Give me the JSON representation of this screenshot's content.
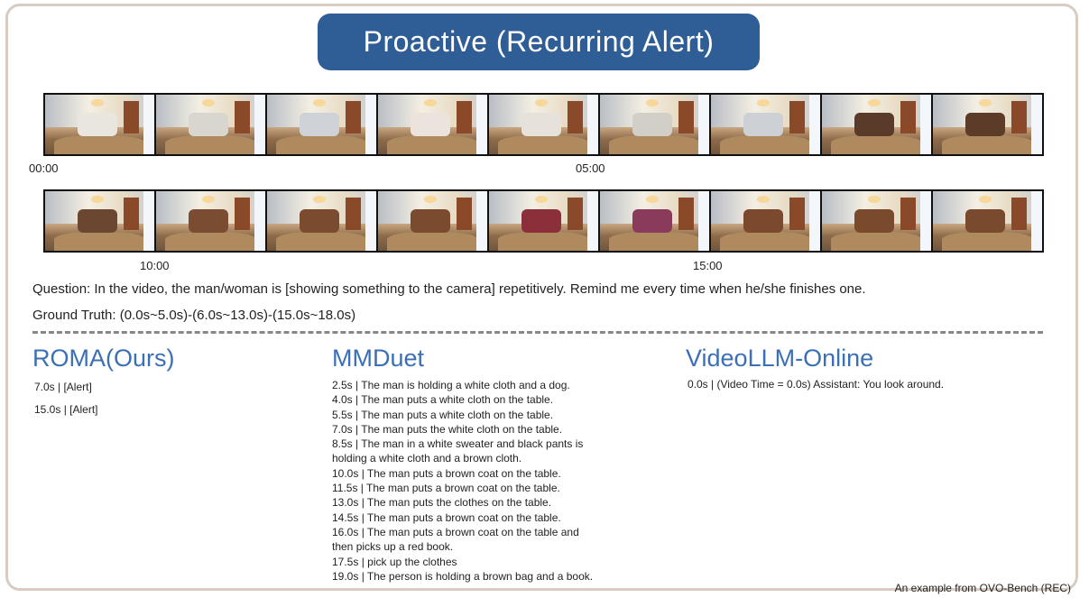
{
  "title": "Proactive (Recurring Alert)",
  "timeline": {
    "labels": [
      "00:00",
      "05:00",
      "10:00",
      "15:00"
    ]
  },
  "strips": {
    "row1": [
      {
        "obj": "#e9e6e0"
      },
      {
        "obj": "#d9d6cf"
      },
      {
        "obj": "#cfd2d6"
      },
      {
        "obj": "#ece4dc"
      },
      {
        "obj": "#e6e1da"
      },
      {
        "obj": "#d2cfc8"
      },
      {
        "obj": "#cdd0d4"
      },
      {
        "obj": "#5a3a28"
      },
      {
        "obj": "#5c3b29"
      }
    ],
    "row2": [
      {
        "obj": "#6b4630"
      },
      {
        "obj": "#7a4d33"
      },
      {
        "obj": "#7a4b2e"
      },
      {
        "obj": "#7b4b2f"
      },
      {
        "obj": "#8b2f3a"
      },
      {
        "obj": "#8a3a5a"
      },
      {
        "obj": "#7b4a2e"
      },
      {
        "obj": "#7a4a2d"
      },
      {
        "obj": "#7a4a2e"
      }
    ]
  },
  "question": "Question: In the video, the man/woman is [showing something to the camera] repetitively. Remind me every time when he/she finishes one.",
  "ground_truth": "Ground Truth: (0.0s~5.0s)-(6.0s~13.0s)-(15.0s~18.0s)",
  "columns": {
    "roma": {
      "title": "ROMA(Ours)",
      "lines": [
        "7.0s  | [Alert]",
        "15.0s | [Alert]"
      ]
    },
    "mmduet": {
      "title": "MMDuet",
      "lines": [
        "2.5s | The man is holding a white cloth and a dog.",
        "4.0s | The man puts a white cloth on the table.",
        "5.5s | The man puts a white cloth on the table.",
        "7.0s | The man puts the white cloth on the table.",
        "8.5s | The man in a white sweater and black pants is",
        "holding a white cloth and a brown cloth.",
        "10.0s | The man puts a brown coat on the table.",
        "11.5s | The man puts a brown coat on the table.",
        "13.0s | The man puts the clothes on the table.",
        "14.5s | The man puts a brown coat on the table.",
        "16.0s | The man puts a brown coat on the table and",
        "then picks up a red book.",
        "17.5s | pick up the clothes",
        "19.0s | The person is holding a brown bag and a book."
      ]
    },
    "videollm": {
      "title": "VideoLLM-Online",
      "lines": [
        "0.0s | (Video Time = 0.0s) Assistant: You look around."
      ]
    }
  },
  "footer": "An example from OVO-Bench (REC)",
  "colors": {
    "title_bg": "#2f5e96",
    "column_title": "#3b6fb6",
    "frame_border": "#d8ccc2"
  }
}
